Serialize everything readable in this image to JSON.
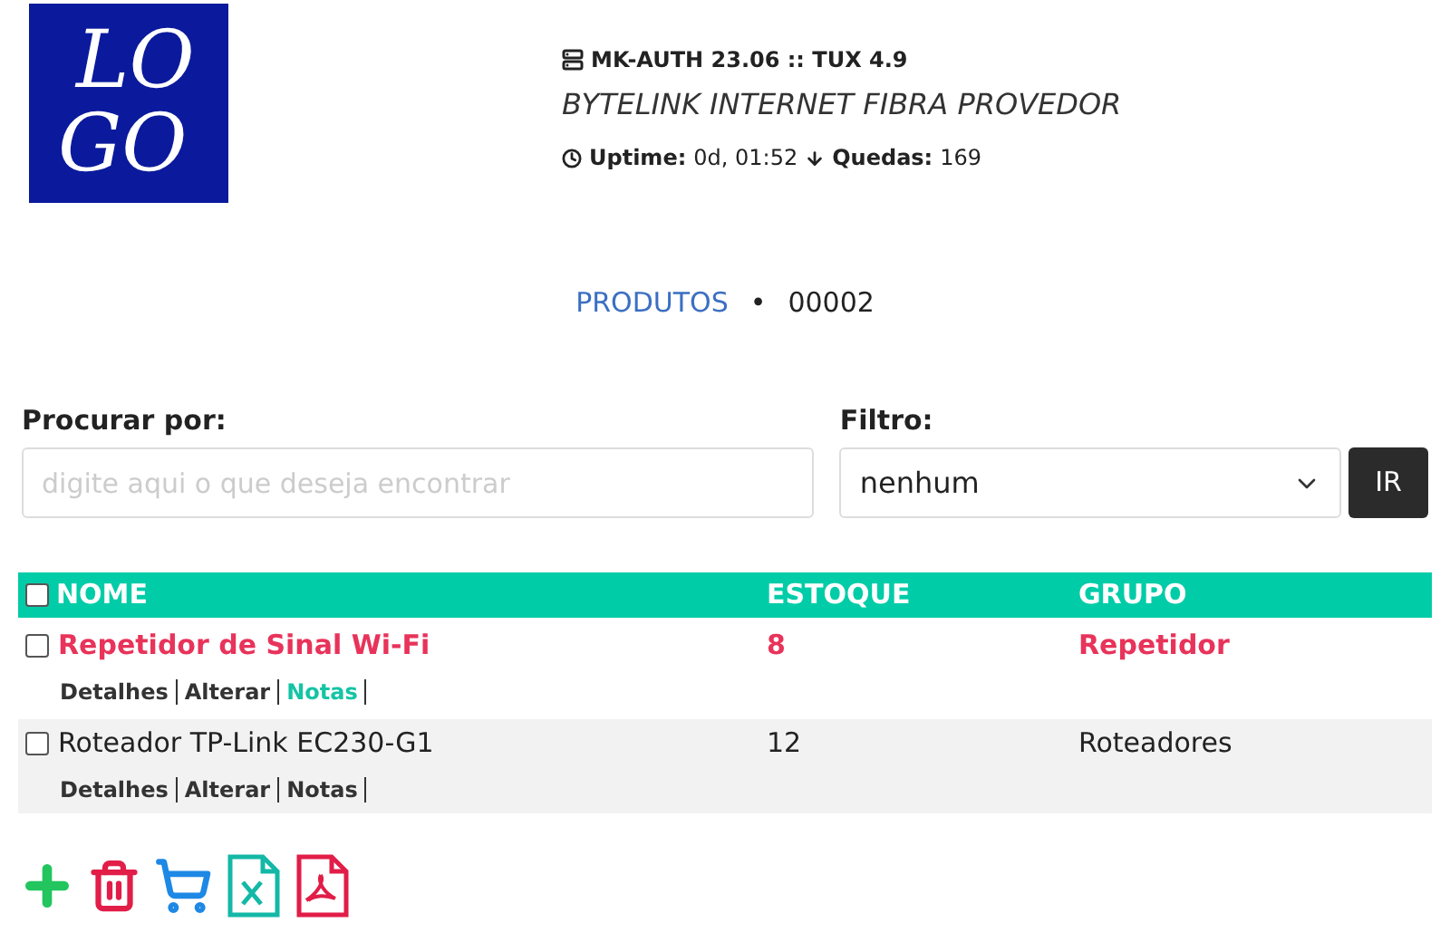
{
  "logo": {
    "lines": [
      "LO",
      "GO"
    ]
  },
  "header": {
    "system": "MK-AUTH 23.06 :: TUX 4.9",
    "provider": "BYTELINK INTERNET FIBRA PROVEDOR",
    "uptime_label": "Uptime:",
    "uptime": "0d, 01:52",
    "drops_label": "Quedas:",
    "drops": "169"
  },
  "breadcrumb": {
    "section": "PRODUTOS",
    "separator": "•",
    "count": "00002"
  },
  "search": {
    "label": "Procurar por:",
    "placeholder": "digite aqui o que deseja encontrar"
  },
  "filter": {
    "label": "Filtro:",
    "value": "nenhum"
  },
  "go_button": "IR",
  "table": {
    "columns": [
      "NOME",
      "ESTOQUE",
      "GRUPO"
    ],
    "select_all_checked": false,
    "rows": [
      {
        "name": "Repetidor de Sinal Wi-Fi",
        "stock": "8",
        "group": "Repetidor",
        "alert": true,
        "checked": false,
        "links": [
          {
            "label": "Detalhes",
            "highlighted": false
          },
          {
            "label": "Alterar",
            "highlighted": false
          },
          {
            "label": "Notas",
            "highlighted": true
          }
        ]
      },
      {
        "name": "Roteador TP-Link EC230-G1",
        "stock": "12",
        "group": "Roteadores",
        "alert": false,
        "checked": false,
        "links": [
          {
            "label": "Detalhes",
            "highlighted": false
          },
          {
            "label": "Alterar",
            "highlighted": false
          },
          {
            "label": "Notas",
            "highlighted": false
          }
        ]
      }
    ]
  },
  "actions": [
    {
      "kind": "add"
    },
    {
      "kind": "delete"
    },
    {
      "kind": "cart"
    },
    {
      "kind": "excel"
    },
    {
      "kind": "pdf"
    }
  ]
}
